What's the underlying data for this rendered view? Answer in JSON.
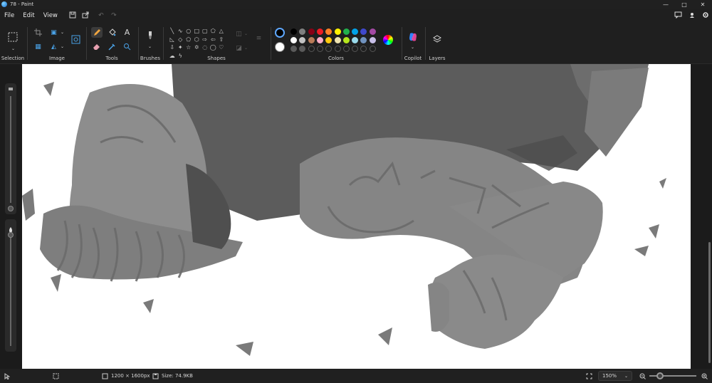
{
  "window": {
    "title": "78 - Paint",
    "controls": {
      "minimize": "—",
      "maximize": "□",
      "close": "✕"
    }
  },
  "menu": {
    "items": [
      {
        "label": "File"
      },
      {
        "label": "Edit"
      },
      {
        "label": "View"
      }
    ],
    "quick": {
      "save_icon": "save-icon",
      "share_icon": "share-icon",
      "undo_icon": "undo-icon",
      "redo_icon": "redo-icon"
    }
  },
  "ribbon": {
    "groups": {
      "selection": "Selection",
      "image": "Image",
      "tools": "Tools",
      "brushes": "Brushes",
      "shapes": "Shapes",
      "colors": "Colors",
      "copilot": "Copilot",
      "layers": "Layers"
    },
    "text_tool_glyph": "A",
    "primary_color": "#000000",
    "secondary_color": "#ffffff",
    "palette_row1": [
      "#000000",
      "#7f7f7f",
      "#880015",
      "#ed1c24",
      "#ff7f27",
      "#fff200",
      "#22b14c",
      "#00a2e8",
      "#3f48cc",
      "#a349a4"
    ],
    "palette_row2": [
      "#ffffff",
      "#c3c3c3",
      "#b97a57",
      "#ffaec9",
      "#ffc90e",
      "#efe4b0",
      "#b5e61d",
      "#99d9ea",
      "#7092be",
      "#c8bfe7"
    ],
    "palette_row3_filled": [
      "#5a5a5a",
      "#5a5a5a"
    ]
  },
  "status": {
    "dimensions": "1200 × 1600px",
    "size": "Size: 74.9KB",
    "zoom": "150%"
  }
}
